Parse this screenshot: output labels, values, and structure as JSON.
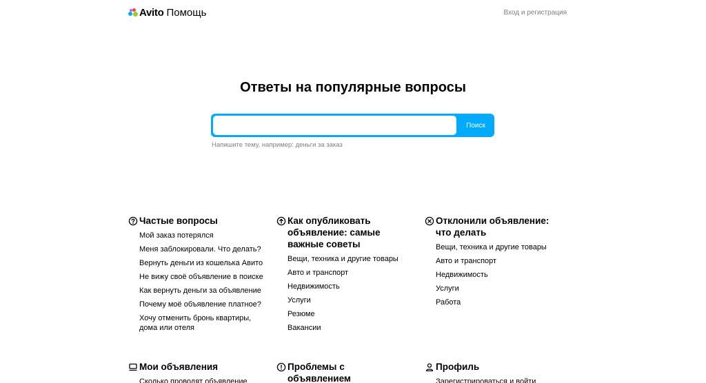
{
  "header": {
    "brand": "Avito",
    "section": "Помощь",
    "login_label": "Вход и регистрация"
  },
  "hero": {
    "title": "Ответы на популярные вопросы",
    "search": {
      "value": "",
      "placeholder": "",
      "button_label": "Поиск",
      "hint": "Напишите тему, например: деньги за заказ"
    }
  },
  "sections": {
    "faq": {
      "icon": "question-circle-icon",
      "title": "Частые вопросы",
      "items": [
        "Мой заказ потерялся",
        "Меня заблокировали. Что делать?",
        "Вернуть деньги из кошелька Авито",
        "Не вижу своё объявление в поиске",
        "Как вернуть деньги за объявление",
        "Почему моё объявление платное?",
        "Хочу отменить бронь квартиры, дома или отеля"
      ]
    },
    "publish": {
      "icon": "arrow-up-circle-icon",
      "title": "Как опубликовать объявление: самые важные советы",
      "items": [
        "Вещи, техника и другие товары",
        "Авто и транспорт",
        "Недвижимость",
        "Услуги",
        "Резюме",
        "Вакансии"
      ]
    },
    "rejected": {
      "icon": "x-circle-icon",
      "title": "Отклонили объявление: что делать",
      "items": [
        "Вещи, техника и другие товары",
        "Авто и транспорт",
        "Недвижимость",
        "Услуги",
        "Работа"
      ]
    },
    "my_ads": {
      "icon": "ads-list-icon",
      "title": "Мои объявления",
      "items": [
        "Сколько проводят объявление"
      ]
    },
    "problems": {
      "icon": "exclamation-circle-icon",
      "title": "Проблемы с объявлением",
      "items": []
    },
    "profile": {
      "icon": "user-icon",
      "title": "Профиль",
      "items": [
        "Зарегистрироваться и войти"
      ]
    }
  },
  "colors": {
    "accent": "#00aaff",
    "muted_text": "#7f7f7f"
  }
}
